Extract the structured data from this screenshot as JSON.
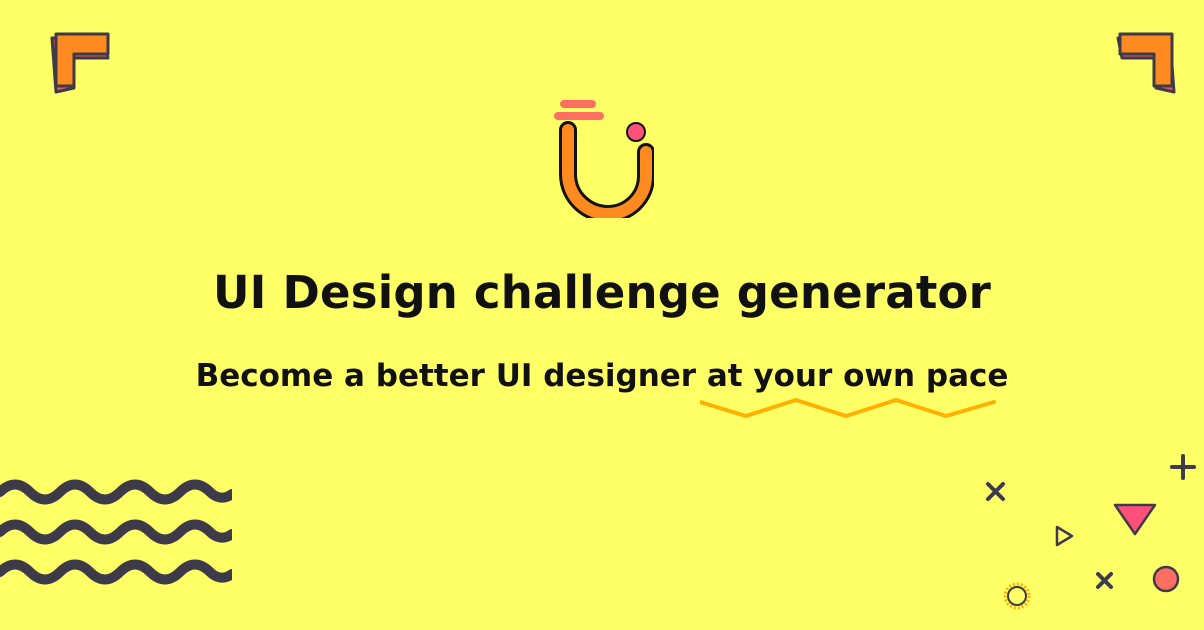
{
  "hero": {
    "title": "UI Design challenge generator",
    "subtitle_main": "Become a better UI designer",
    "subtitle_emphasis": "at your own pace"
  },
  "colors": {
    "background": "#FFFF66",
    "text": "#111111",
    "orange": "#FF8A1F",
    "pink": "#FF4F7B",
    "magenta": "#E52E78",
    "dark": "#3D3A4A",
    "gold": "#FFB000"
  },
  "icons": {
    "logo": "u-logo-icon",
    "left_bracket": "corner-bracket-icon",
    "right_bracket": "corner-bracket-icon",
    "waves": "waves-decoration",
    "confetti": "confetti-decoration"
  }
}
